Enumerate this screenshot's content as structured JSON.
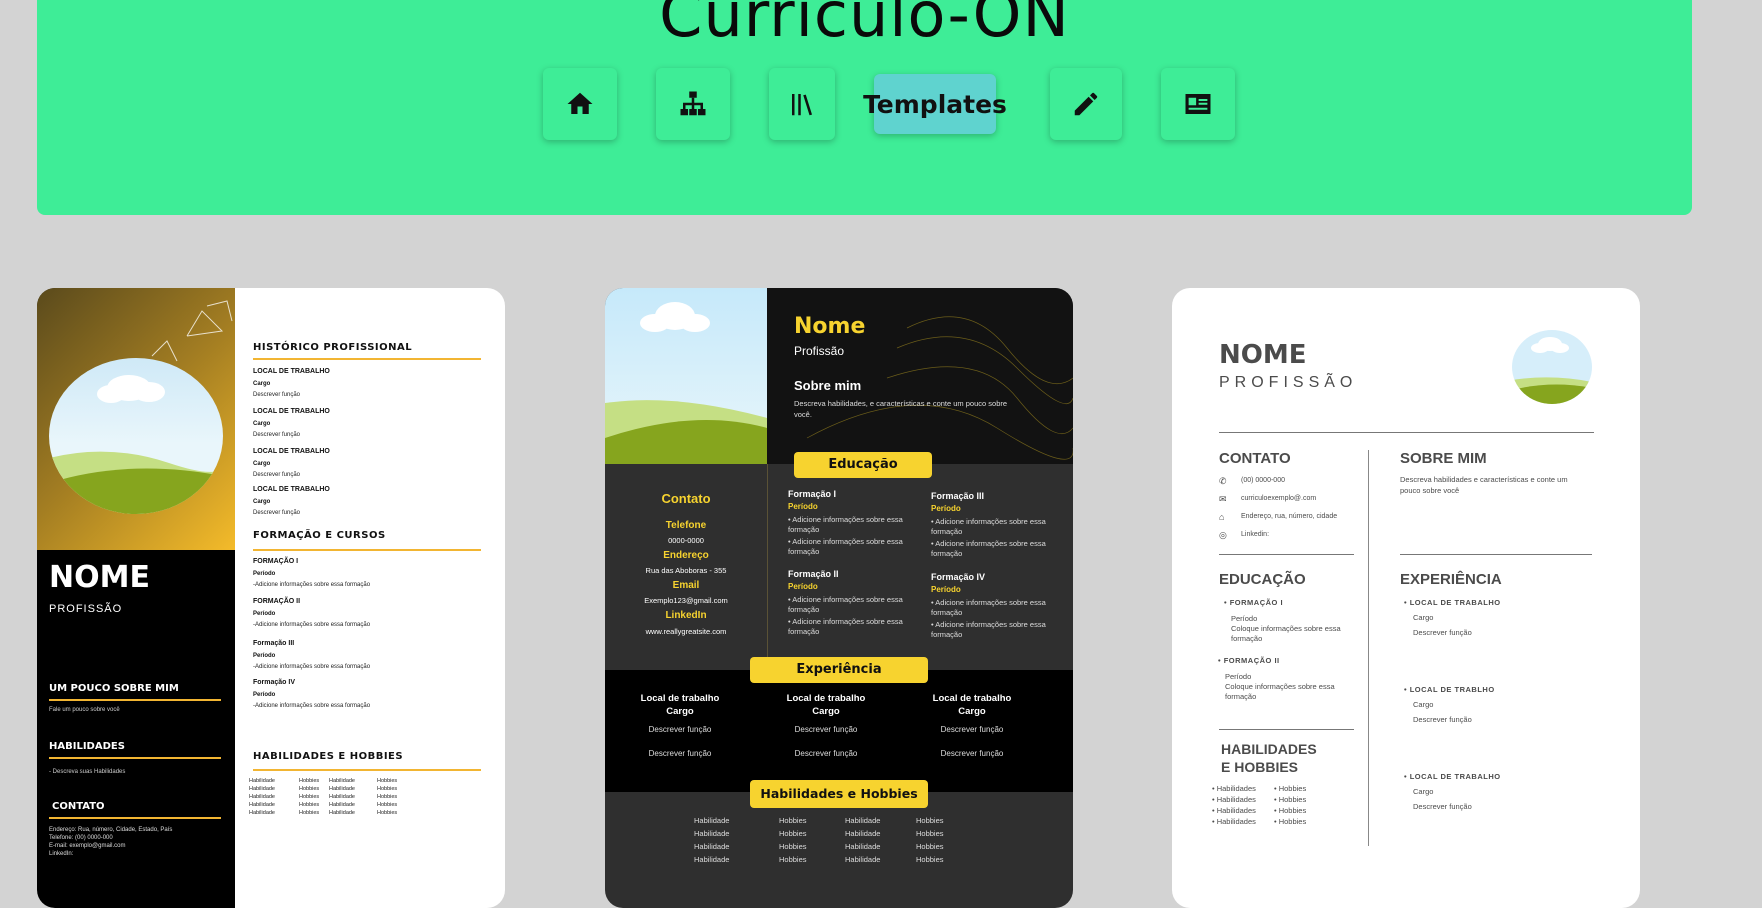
{
  "site": {
    "title": "Currículo-ON"
  },
  "nav": [
    {
      "icon": "home-icon",
      "label": ""
    },
    {
      "icon": "sitemap-icon",
      "label": ""
    },
    {
      "icon": "books-icon",
      "label": ""
    },
    {
      "icon": "",
      "label": "Templates"
    },
    {
      "icon": "pencil-icon",
      "label": ""
    },
    {
      "icon": "id-card-icon",
      "label": ""
    }
  ],
  "colors": {
    "header": "#3eed97",
    "active": "#5fd3cf",
    "accent_yellow": "#f7d32f",
    "accent_gold": "#f2b532"
  },
  "t1": {
    "name": "NOME",
    "profession": "PROFISSÃO",
    "about_title": "UM POUCO SOBRE MIM",
    "about_text": "Fale um pouco sobre você",
    "skills_title": "HABILIDADES",
    "skills_text": "- Descreva suas Habilidades",
    "contact_title": "CONTATO",
    "contact_lines": [
      "Endereço: Rua, número, Cidade, Estado, País",
      "Telefone: (00) 0000-000",
      "E-mail: exemplo@gmail.com",
      "LinkedIn:"
    ],
    "history_title": "HISTÓRICO PROFISSIONAL",
    "jobs": [
      {
        "place": "LOCAL DE TRABALHO",
        "role": "Cargo",
        "desc": "Descrever função"
      },
      {
        "place": "LOCAL DE TRABALHO",
        "role": "Cargo",
        "desc": "Descrever função"
      },
      {
        "place": "LOCAL DE TRABALHO",
        "role": "Cargo",
        "desc": "Descrever função"
      },
      {
        "place": "LOCAL DE TRABALHO",
        "role": "Cargo",
        "desc": "Descrever função"
      }
    ],
    "education_title": "FORMAÇÃO E CURSOS",
    "courses": [
      {
        "name": "FORMAÇÃO I",
        "period": "Período",
        "desc": "-Adicione informações sobre essa formação"
      },
      {
        "name": "FORMAÇÃO II",
        "period": "Período",
        "desc": "-Adicione informações sobre essa formação"
      },
      {
        "name": "Formação III",
        "period": "Período",
        "desc": "-Adicione informações sobre essa formação"
      },
      {
        "name": "Formação IV",
        "period": "Período",
        "desc": "-Adicione informações sobre essa formação"
      }
    ],
    "hobbies_title": "HABILIDADES E HOBBIES",
    "hobby_cols": [
      [
        "Habilidade",
        "Habilidade",
        "Habilidade",
        "Habilidade",
        "Habilidade"
      ],
      [
        "Hobbies",
        "Hobbies",
        "Hobbies",
        "Hobbies",
        "Hobbies"
      ],
      [
        "Habilidade",
        "Habilidade",
        "Habilidade",
        "Habilidade",
        "Habilidade"
      ],
      [
        "Hobbies",
        "Hobbies",
        "Hobbies",
        "Hobbies",
        "Hobbies"
      ]
    ]
  },
  "t2": {
    "name": "Nome",
    "profession": "Profissão",
    "about_title": "Sobre mim",
    "about_text": "Descreva habilidades, e características e conte um pouco sobre você.",
    "contact_title": "Contato",
    "phone_label": "Telefone",
    "phone": "0000-0000",
    "address_label": "Endereço",
    "address": "Rua das Aboboras - 355",
    "email_label": "Email",
    "email": "Exemplo123@gmail.com",
    "linkedin_label": "LinkedIn",
    "linkedin": "www.reallygreatsite.com",
    "education_title": "Educação",
    "courses": [
      {
        "name": "Formação I",
        "period": "Período",
        "items": [
          "Adicione informações sobre essa formação",
          "Adicione informações sobre essa formação"
        ]
      },
      {
        "name": "Formação III",
        "period": "Período",
        "items": [
          "Adicione informações sobre essa formação",
          "Adicione informações sobre essa formação"
        ]
      },
      {
        "name": "Formação II",
        "period": "Período",
        "items": [
          "Adicione informações sobre essa formação",
          "Adicione informações sobre essa formação"
        ]
      },
      {
        "name": "Formação IV",
        "period": "Período",
        "items": [
          "Adicione informações sobre essa formação",
          "Adicione informações sobre essa formação"
        ]
      }
    ],
    "experience_title": "Experiência",
    "jobs": [
      {
        "place": "Local de trabalho",
        "role": "Cargo",
        "d1": "Descrever função",
        "d2": "Descrever função"
      },
      {
        "place": "Local de trabalho",
        "role": "Cargo",
        "d1": "Descrever função",
        "d2": "Descrever função"
      },
      {
        "place": "Local de trabalho",
        "role": "Cargo",
        "d1": "Descrever função",
        "d2": "Descrever função"
      }
    ],
    "hobbies_title": "Habilidades e Hobbies",
    "hobby_cols": [
      [
        "Habilidade",
        "Habilidade",
        "Habilidade",
        "Habilidade"
      ],
      [
        "Hobbies",
        "Hobbies",
        "Hobbies",
        "Hobbies"
      ],
      [
        "Habilidade",
        "Habilidade",
        "Habilidade",
        "Habilidade"
      ],
      [
        "Hobbies",
        "Hobbies",
        "Hobbies",
        "Hobbies"
      ]
    ]
  },
  "t3": {
    "name": "NOME",
    "profession": "PROFISSÃO",
    "contact_title": "CONTATO",
    "contacts": [
      {
        "icon": "phone-icon",
        "text": "(00) 0000-000"
      },
      {
        "icon": "mail-icon",
        "text": "curriculoexemplo@.com"
      },
      {
        "icon": "location-icon",
        "text": "Endereço, rua, número, cidade"
      },
      {
        "icon": "globe-icon",
        "text": "Linkedin:"
      }
    ],
    "about_title": "SOBRE MIM",
    "about_text": "Descreva habilidades e características e conte um pouco sobre você",
    "education_title": "EDUCAÇÃO",
    "courses": [
      {
        "name": "FORMAÇÃO I",
        "period": "Período",
        "desc": "Coloque informações sobre essa formação"
      },
      {
        "name": "FORMAÇÃO II",
        "period": "Período",
        "desc": "Coloque informações sobre essa formação"
      }
    ],
    "experience_title": "EXPERIÊNCIA",
    "jobs": [
      {
        "place": "LOCAL DE TRABALHO",
        "role": "Cargo",
        "desc": "Descrever função"
      },
      {
        "place": "LOCAL DE TRABLHO",
        "role": "Cargo",
        "desc": "Descrever função"
      },
      {
        "place": "LOCAL DE TRABALHO",
        "role": "Cargo",
        "desc": "Descrever função"
      }
    ],
    "hobbies_title_1": "HABILIDADES",
    "hobbies_title_2": "E HOBBIES",
    "skills": [
      "Habilidades",
      "Habilidades",
      "Habilidades",
      "Habilidades"
    ],
    "hobbies": [
      "Hobbies",
      "Hobbies",
      "Hobbies",
      "Hobbies"
    ]
  }
}
